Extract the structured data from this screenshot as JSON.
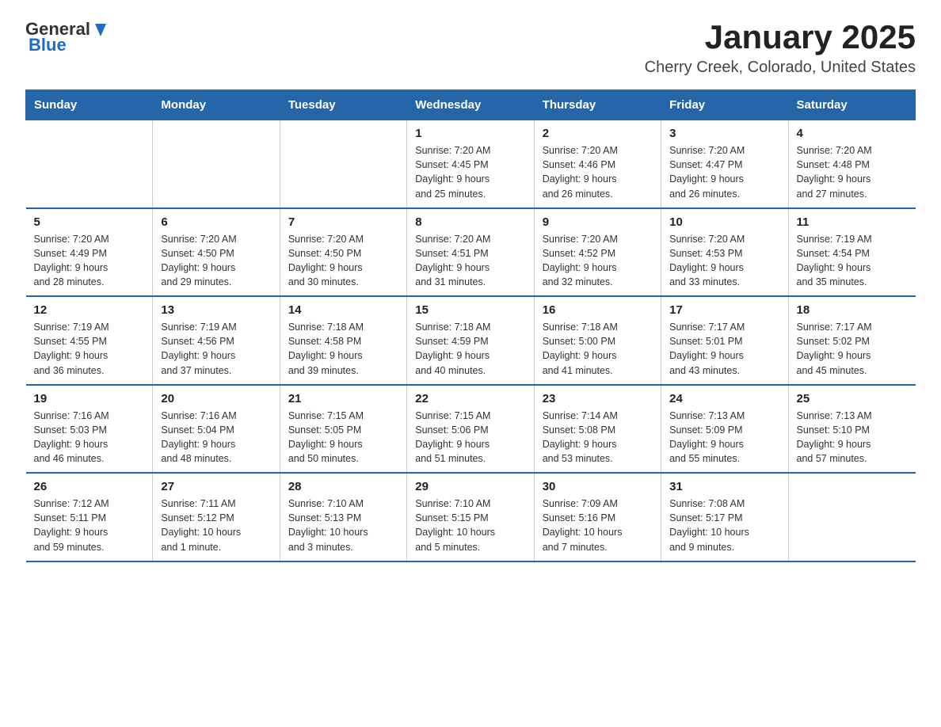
{
  "logo": {
    "general": "General",
    "blue": "Blue"
  },
  "title": "January 2025",
  "subtitle": "Cherry Creek, Colorado, United States",
  "days_of_week": [
    "Sunday",
    "Monday",
    "Tuesday",
    "Wednesday",
    "Thursday",
    "Friday",
    "Saturday"
  ],
  "weeks": [
    [
      {
        "day": "",
        "info": ""
      },
      {
        "day": "",
        "info": ""
      },
      {
        "day": "",
        "info": ""
      },
      {
        "day": "1",
        "info": "Sunrise: 7:20 AM\nSunset: 4:45 PM\nDaylight: 9 hours\nand 25 minutes."
      },
      {
        "day": "2",
        "info": "Sunrise: 7:20 AM\nSunset: 4:46 PM\nDaylight: 9 hours\nand 26 minutes."
      },
      {
        "day": "3",
        "info": "Sunrise: 7:20 AM\nSunset: 4:47 PM\nDaylight: 9 hours\nand 26 minutes."
      },
      {
        "day": "4",
        "info": "Sunrise: 7:20 AM\nSunset: 4:48 PM\nDaylight: 9 hours\nand 27 minutes."
      }
    ],
    [
      {
        "day": "5",
        "info": "Sunrise: 7:20 AM\nSunset: 4:49 PM\nDaylight: 9 hours\nand 28 minutes."
      },
      {
        "day": "6",
        "info": "Sunrise: 7:20 AM\nSunset: 4:50 PM\nDaylight: 9 hours\nand 29 minutes."
      },
      {
        "day": "7",
        "info": "Sunrise: 7:20 AM\nSunset: 4:50 PM\nDaylight: 9 hours\nand 30 minutes."
      },
      {
        "day": "8",
        "info": "Sunrise: 7:20 AM\nSunset: 4:51 PM\nDaylight: 9 hours\nand 31 minutes."
      },
      {
        "day": "9",
        "info": "Sunrise: 7:20 AM\nSunset: 4:52 PM\nDaylight: 9 hours\nand 32 minutes."
      },
      {
        "day": "10",
        "info": "Sunrise: 7:20 AM\nSunset: 4:53 PM\nDaylight: 9 hours\nand 33 minutes."
      },
      {
        "day": "11",
        "info": "Sunrise: 7:19 AM\nSunset: 4:54 PM\nDaylight: 9 hours\nand 35 minutes."
      }
    ],
    [
      {
        "day": "12",
        "info": "Sunrise: 7:19 AM\nSunset: 4:55 PM\nDaylight: 9 hours\nand 36 minutes."
      },
      {
        "day": "13",
        "info": "Sunrise: 7:19 AM\nSunset: 4:56 PM\nDaylight: 9 hours\nand 37 minutes."
      },
      {
        "day": "14",
        "info": "Sunrise: 7:18 AM\nSunset: 4:58 PM\nDaylight: 9 hours\nand 39 minutes."
      },
      {
        "day": "15",
        "info": "Sunrise: 7:18 AM\nSunset: 4:59 PM\nDaylight: 9 hours\nand 40 minutes."
      },
      {
        "day": "16",
        "info": "Sunrise: 7:18 AM\nSunset: 5:00 PM\nDaylight: 9 hours\nand 41 minutes."
      },
      {
        "day": "17",
        "info": "Sunrise: 7:17 AM\nSunset: 5:01 PM\nDaylight: 9 hours\nand 43 minutes."
      },
      {
        "day": "18",
        "info": "Sunrise: 7:17 AM\nSunset: 5:02 PM\nDaylight: 9 hours\nand 45 minutes."
      }
    ],
    [
      {
        "day": "19",
        "info": "Sunrise: 7:16 AM\nSunset: 5:03 PM\nDaylight: 9 hours\nand 46 minutes."
      },
      {
        "day": "20",
        "info": "Sunrise: 7:16 AM\nSunset: 5:04 PM\nDaylight: 9 hours\nand 48 minutes."
      },
      {
        "day": "21",
        "info": "Sunrise: 7:15 AM\nSunset: 5:05 PM\nDaylight: 9 hours\nand 50 minutes."
      },
      {
        "day": "22",
        "info": "Sunrise: 7:15 AM\nSunset: 5:06 PM\nDaylight: 9 hours\nand 51 minutes."
      },
      {
        "day": "23",
        "info": "Sunrise: 7:14 AM\nSunset: 5:08 PM\nDaylight: 9 hours\nand 53 minutes."
      },
      {
        "day": "24",
        "info": "Sunrise: 7:13 AM\nSunset: 5:09 PM\nDaylight: 9 hours\nand 55 minutes."
      },
      {
        "day": "25",
        "info": "Sunrise: 7:13 AM\nSunset: 5:10 PM\nDaylight: 9 hours\nand 57 minutes."
      }
    ],
    [
      {
        "day": "26",
        "info": "Sunrise: 7:12 AM\nSunset: 5:11 PM\nDaylight: 9 hours\nand 59 minutes."
      },
      {
        "day": "27",
        "info": "Sunrise: 7:11 AM\nSunset: 5:12 PM\nDaylight: 10 hours\nand 1 minute."
      },
      {
        "day": "28",
        "info": "Sunrise: 7:10 AM\nSunset: 5:13 PM\nDaylight: 10 hours\nand 3 minutes."
      },
      {
        "day": "29",
        "info": "Sunrise: 7:10 AM\nSunset: 5:15 PM\nDaylight: 10 hours\nand 5 minutes."
      },
      {
        "day": "30",
        "info": "Sunrise: 7:09 AM\nSunset: 5:16 PM\nDaylight: 10 hours\nand 7 minutes."
      },
      {
        "day": "31",
        "info": "Sunrise: 7:08 AM\nSunset: 5:17 PM\nDaylight: 10 hours\nand 9 minutes."
      },
      {
        "day": "",
        "info": ""
      }
    ]
  ]
}
